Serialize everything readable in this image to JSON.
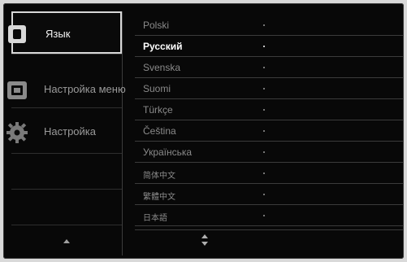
{
  "sidebar": {
    "items": [
      {
        "label": "Язык",
        "icon": "language-icon",
        "selected": true
      },
      {
        "label": "Настройка меню",
        "icon": "menu-settings-icon",
        "selected": false
      },
      {
        "label": "Настройка",
        "icon": "gear-icon",
        "selected": false
      }
    ],
    "scroll_icon": "up-arrow-icon"
  },
  "languages": {
    "items": [
      {
        "label": "Polski",
        "selected": false
      },
      {
        "label": "Русский",
        "selected": true
      },
      {
        "label": "Svenska",
        "selected": false
      },
      {
        "label": "Suomi",
        "selected": false
      },
      {
        "label": "Türkçe",
        "selected": false
      },
      {
        "label": "Čeština",
        "selected": false
      },
      {
        "label": "Українська",
        "selected": false
      },
      {
        "label": "简体中文",
        "selected": false
      },
      {
        "label": "繁體中文",
        "selected": false
      },
      {
        "label": "日本語",
        "selected": false
      }
    ],
    "scroll_icon": "up-down-arrows-icon"
  },
  "colors": {
    "background": "#080808",
    "selected_text": "#ffffff",
    "normal_text": "#8a8a8a",
    "highlight_border": "#d8d8d8"
  }
}
